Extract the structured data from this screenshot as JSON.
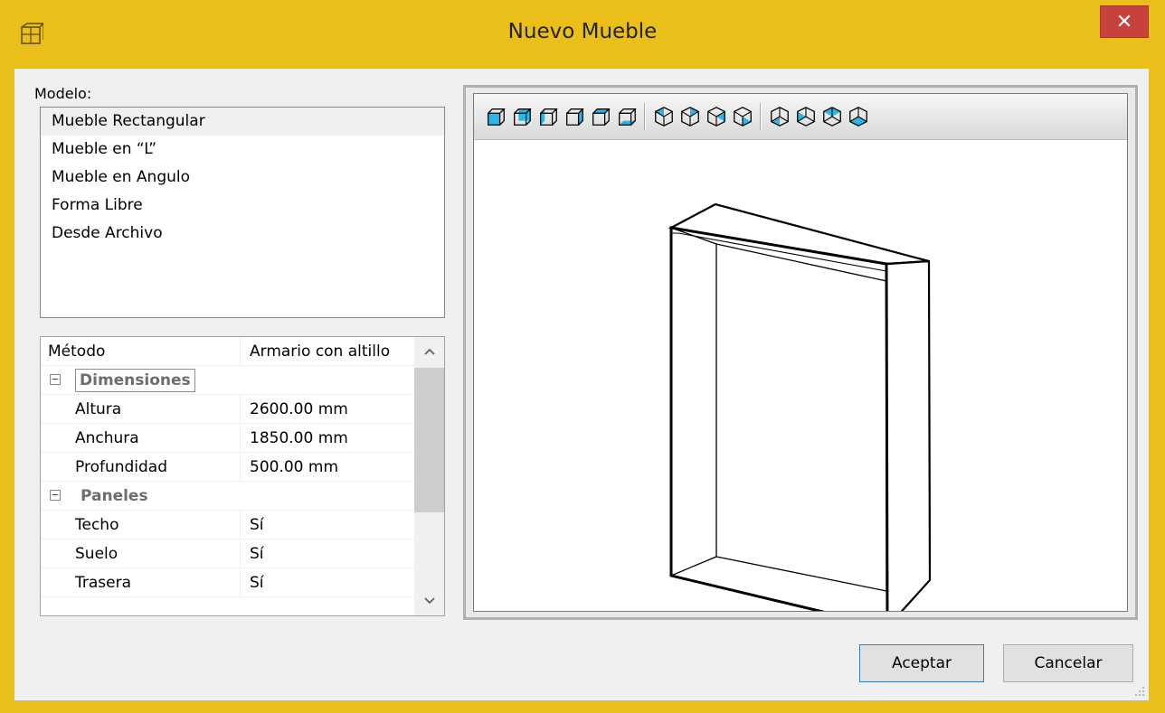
{
  "window": {
    "title": "Nuevo Mueble",
    "close_glyph": "✕"
  },
  "modelo": {
    "label": "Modelo:",
    "items": [
      "Mueble Rectangular",
      "Mueble en “L”",
      "Mueble en Angulo",
      "Forma Libre",
      "Desde Archivo"
    ],
    "selected_index": 0
  },
  "properties": {
    "header": {
      "name": "Método",
      "value": "Armario con altillo"
    },
    "categories": [
      {
        "toggle": "⊟",
        "name": "Dimensiones",
        "rows": [
          {
            "name": "Altura",
            "value": "2600.00 mm"
          },
          {
            "name": "Anchura",
            "value": "1850.00 mm"
          },
          {
            "name": "Profundidad",
            "value": "500.00 mm"
          }
        ]
      },
      {
        "toggle": "⊟",
        "name": "Paneles",
        "rows": [
          {
            "name": "Techo",
            "value": "Sí"
          },
          {
            "name": "Suelo",
            "value": "Sí"
          },
          {
            "name": "Trasera",
            "value": "Sí"
          }
        ]
      }
    ],
    "scroll_up_glyph": "^",
    "scroll_down_glyph": "v"
  },
  "preview_toolbar": {
    "groups": [
      [
        "view-front-icon",
        "view-back-icon",
        "view-left-icon",
        "view-right-icon",
        "view-top-icon",
        "view-bottom-icon"
      ],
      [
        "iso-view-1-icon",
        "iso-view-2-icon",
        "iso-view-3-icon",
        "iso-view-4-icon"
      ],
      [
        "iso-view-5-icon",
        "iso-view-6-icon",
        "iso-view-7-icon",
        "iso-view-8-icon"
      ]
    ],
    "accent_color": "#29b6e8"
  },
  "buttons": {
    "ok": "Aceptar",
    "cancel": "Cancelar"
  },
  "colors": {
    "frame": "#ebbf19",
    "close": "#c7423b",
    "client": "#f0f0f0"
  }
}
